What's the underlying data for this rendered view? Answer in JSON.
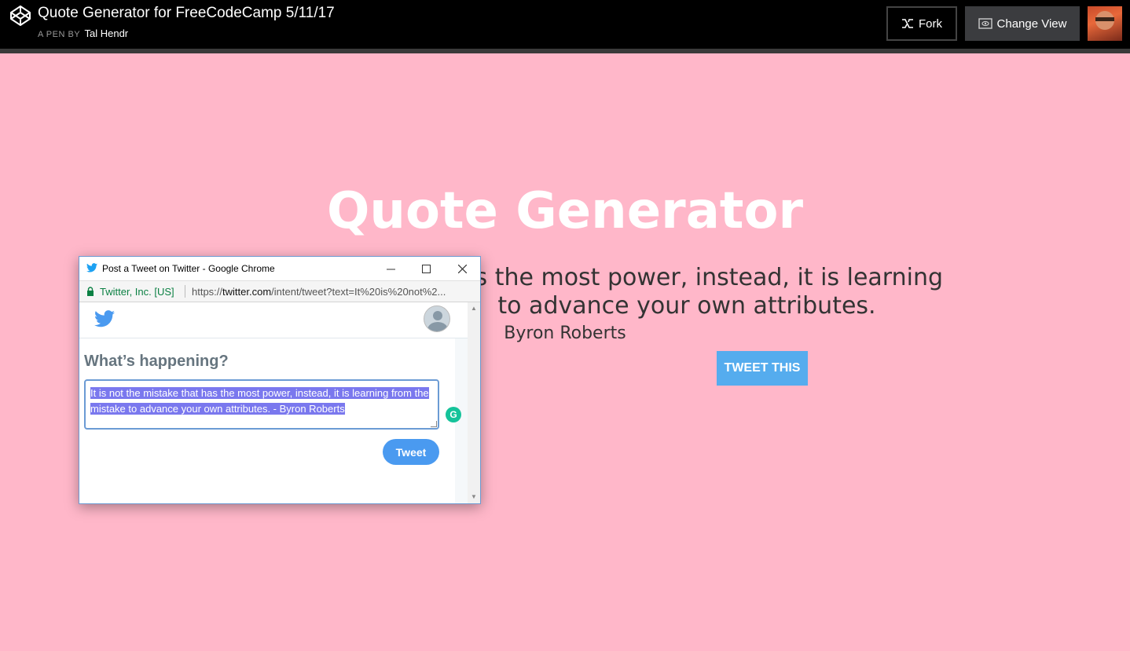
{
  "header": {
    "title": "Quote Generator for FreeCodeCamp 5/11/17",
    "byline_prefix": "A PEN BY",
    "author": "Tal Hendr",
    "fork_label": "Fork",
    "change_view_label": "Change View"
  },
  "page": {
    "title": "Quote Generator",
    "quote_visible_line1": "as the most power, instead, it is learning",
    "quote_visible_line2": "to advance your own attributes.",
    "author": "Byron Roberts",
    "tweet_button": "TWEET THIS",
    "background_color": "#ffb7c9"
  },
  "popup": {
    "window_title": "Post a Tweet on Twitter - Google Chrome",
    "site_label": "Twitter, Inc. [US]",
    "url_scheme": "https://",
    "url_host": "twitter.com",
    "url_path": "/intent/tweet?text=It%20is%20not%2...",
    "heading": "What’s happening?",
    "tweet_text": "It is not the mistake that has the most power, instead, it is learning from the mistake to advance your own attributes.  - Byron Roberts",
    "tweet_button": "Tweet",
    "grammarly_glyph": "G",
    "accent_color": "#4a9af0"
  }
}
